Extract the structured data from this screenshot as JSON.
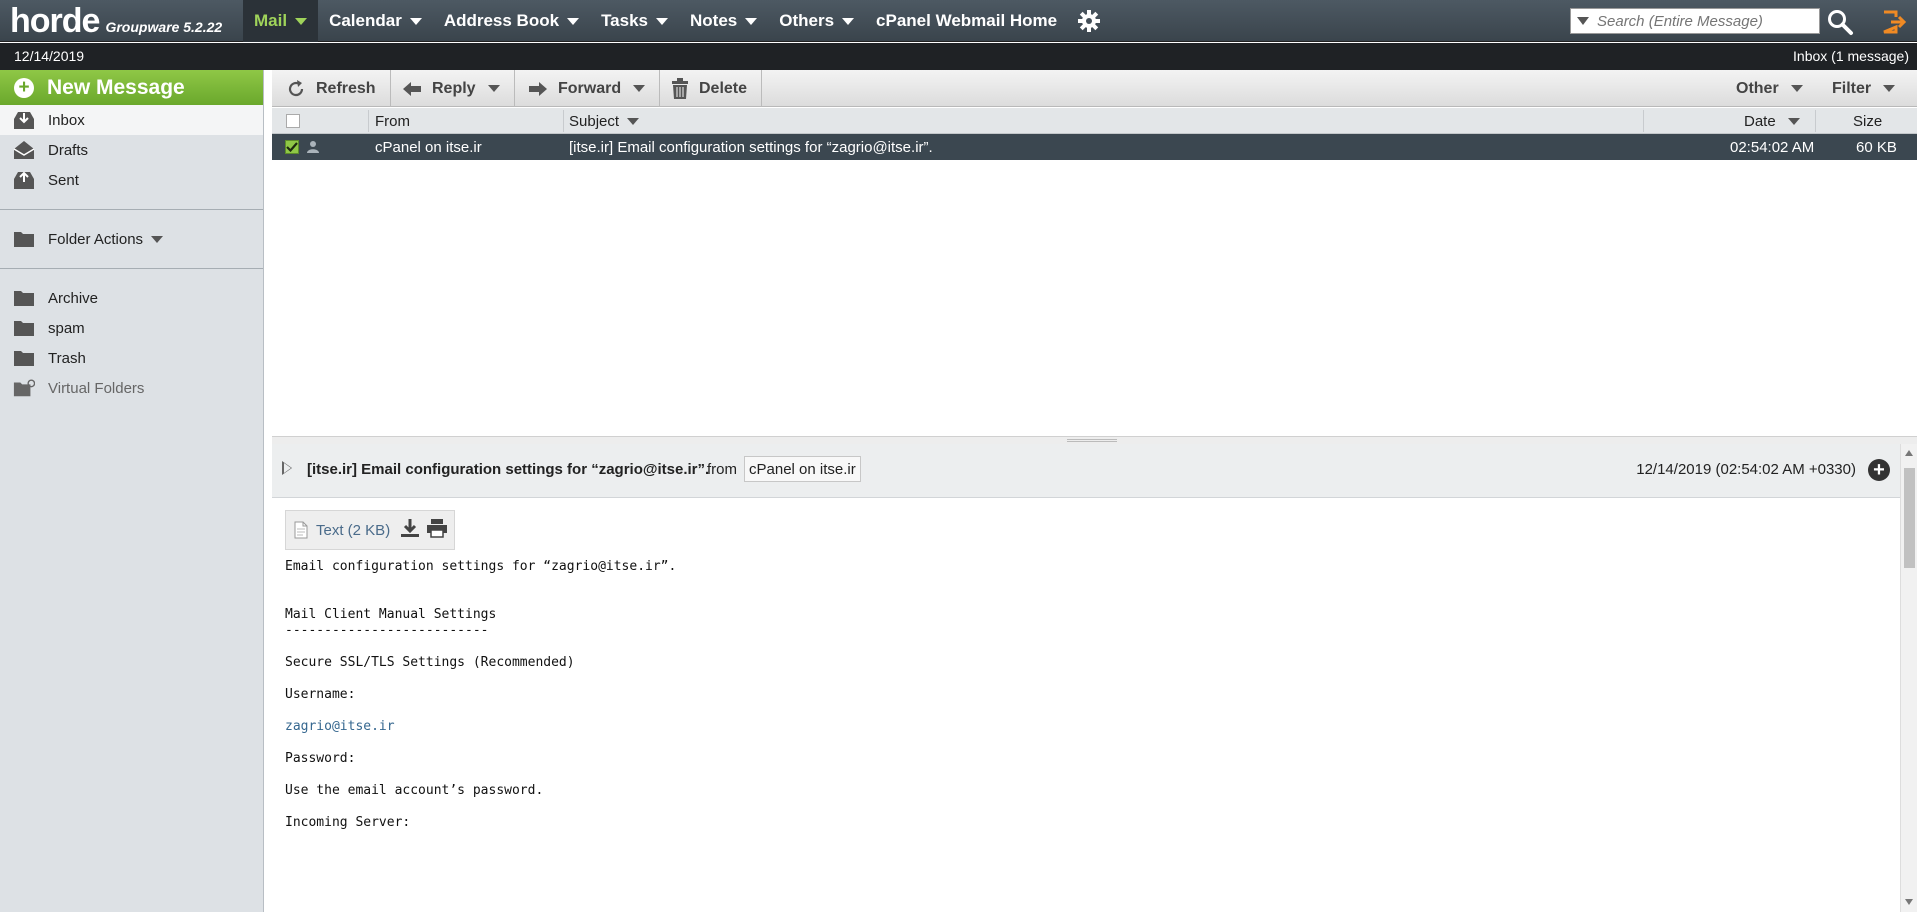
{
  "app": {
    "logo": "horde",
    "version": "Groupware 5.2.22"
  },
  "nav": {
    "mail": "Mail",
    "calendar": "Calendar",
    "address_book": "Address Book",
    "tasks": "Tasks",
    "notes": "Notes",
    "others": "Others",
    "cpanel": "cPanel Webmail Home"
  },
  "search": {
    "placeholder": "Search (Entire Message)"
  },
  "status": {
    "date": "12/14/2019",
    "mailbox": "Inbox (1 message)"
  },
  "sidebar": {
    "new_message": "New Message",
    "inbox": "Inbox",
    "drafts": "Drafts",
    "sent": "Sent",
    "folder_actions": "Folder Actions",
    "archive": "Archive",
    "spam": "spam",
    "trash": "Trash",
    "virtual_folders": "Virtual Folders"
  },
  "toolbar": {
    "refresh": "Refresh",
    "reply": "Reply",
    "forward": "Forward",
    "delete": "Delete",
    "other": "Other",
    "filter": "Filter"
  },
  "list": {
    "headers": {
      "from": "From",
      "subject": "Subject",
      "date": "Date",
      "size": "Size"
    },
    "rows": [
      {
        "from": "cPanel on itse.ir",
        "subject": "[itse.ir] Email configuration settings for “zagrio@itse.ir”.",
        "date": "02:54:02 AM",
        "size": "60 KB"
      }
    ]
  },
  "preview": {
    "subject": "[itse.ir] Email configuration settings for “zagrio@itse.ir”.",
    "from_label": "from",
    "sender": "cPanel on itse.ir",
    "date": "12/14/2019 (02:54:02 AM +0330)",
    "attachment": "Text (2 KB)",
    "body": {
      "line1": "Email configuration settings for “zagrio@itse.ir”.",
      "line2": "Mail Client Manual Settings",
      "line3": "--------------------------",
      "line4": "Secure SSL/TLS Settings (Recommended)",
      "line5": "Username:",
      "line6": "zagrio@itse.ir",
      "line7": "Password:",
      "line8": "Use the email account’s password.",
      "line9": "Incoming Server:"
    }
  },
  "colors": {
    "nav_bg": "#3f4a53",
    "accent_green": "#7ab83a",
    "selected_row": "#3b4750"
  }
}
